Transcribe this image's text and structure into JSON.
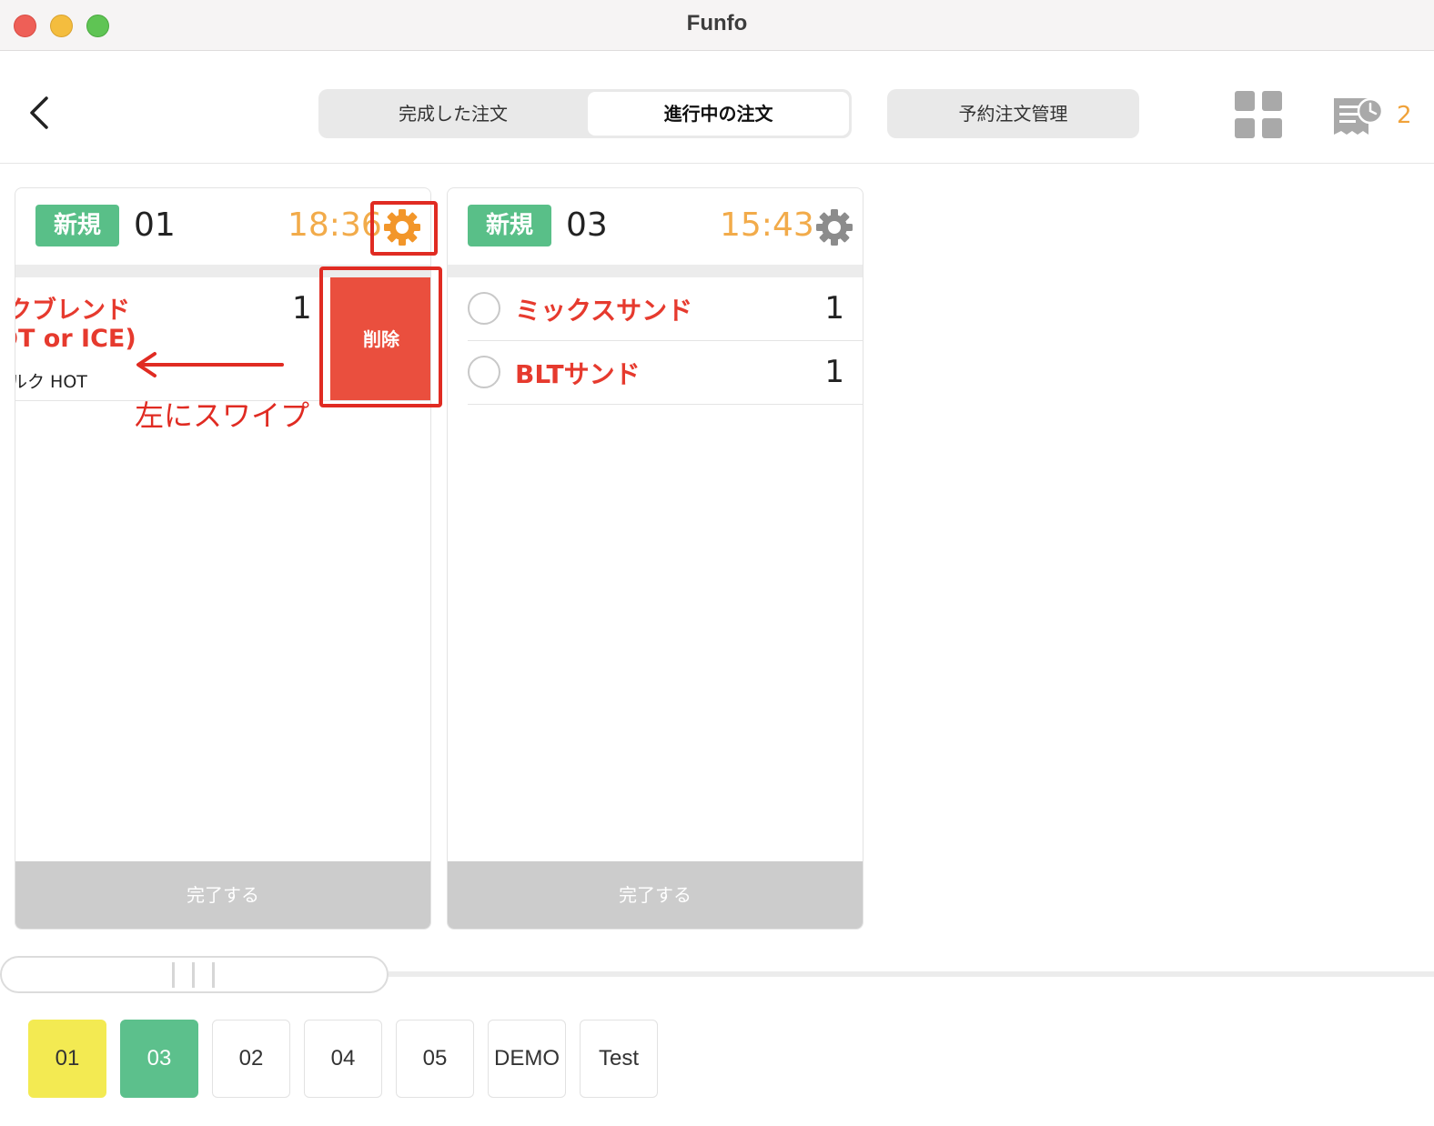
{
  "window": {
    "title": "Funfo"
  },
  "header": {
    "segments": [
      "完成した注文",
      "進行中の注文"
    ],
    "active_segment": "進行中の注文",
    "reservation_label": "予約注文管理",
    "receipt_count": "2",
    "icons": {
      "back": "chevron-left-icon",
      "grid": "grid-view-icon",
      "receipt": "receipt-clock-icon"
    }
  },
  "orders": [
    {
      "badge": "新規",
      "number": "01",
      "time": "18:36",
      "swiped_item": {
        "line1": "ルクブレンド",
        "line2": "OT or ICE)",
        "option": "ルク HOT",
        "qty": "1",
        "delete_label": "削除"
      },
      "footer": "完了する"
    },
    {
      "badge": "新規",
      "number": "03",
      "time": "15:43",
      "items": [
        {
          "name": "ミックスサンド",
          "qty": "1"
        },
        {
          "name": "BLTサンド",
          "qty": "1"
        }
      ],
      "footer": "完了する"
    }
  ],
  "annotation": {
    "text": "左にスワイプ"
  },
  "tables": [
    "01",
    "03",
    "02",
    "04",
    "05",
    "DEMO",
    "Test"
  ],
  "colors": {
    "badge_green": "#59bf88",
    "time_orange": "#f2ab4a",
    "item_red": "#e63a2e",
    "delete_red": "#ea4f3e",
    "annotation_red": "#e02b22",
    "table_active_yellow": "#f3ea52",
    "table_active_green": "#5cc08c"
  }
}
